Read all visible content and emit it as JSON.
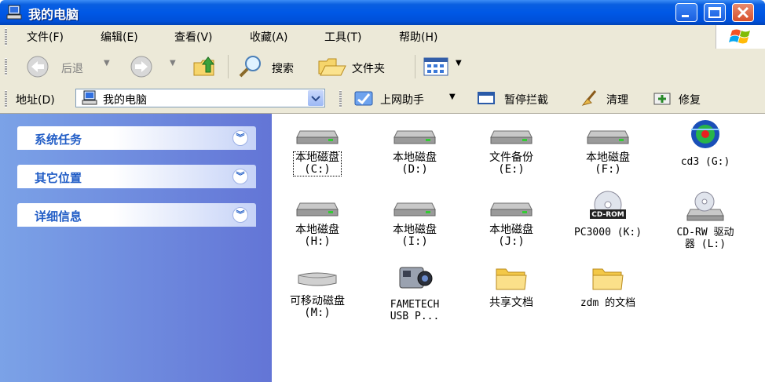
{
  "window": {
    "title": "我的电脑"
  },
  "menu": [
    "文件(F)",
    "编辑(E)",
    "查看(V)",
    "收藏(A)",
    "工具(T)",
    "帮助(H)"
  ],
  "toolbar": {
    "back": "后退",
    "search": "搜索",
    "folders": "文件夹"
  },
  "address": {
    "label": "地址(D)",
    "value": "我的电脑"
  },
  "helper": {
    "assistant": "上网助手",
    "block": "暂停拦截",
    "clean": "清理",
    "repair": "修复"
  },
  "sidebar": [
    "系统任务",
    "其它位置",
    "详细信息"
  ],
  "items": [
    {
      "line1": "本地磁盘",
      "line2": "(C:)",
      "type": "drive"
    },
    {
      "line1": "本地磁盘",
      "line2": "(D:)",
      "type": "drive"
    },
    {
      "line1": "文件备份",
      "line2": "(E:)",
      "type": "drive"
    },
    {
      "line1": "本地磁盘",
      "line2": "(F:)",
      "type": "drive"
    },
    {
      "line1": "cd3 (G:)",
      "line2": "",
      "type": "disc-app"
    },
    {
      "line1": "本地磁盘",
      "line2": "(H:)",
      "type": "drive"
    },
    {
      "line1": "本地磁盘",
      "line2": "(I:)",
      "type": "drive"
    },
    {
      "line1": "本地磁盘",
      "line2": "(J:)",
      "type": "drive"
    },
    {
      "line1": "PC3000 (K:)",
      "line2": "",
      "type": "cdrom"
    },
    {
      "line1": "CD-RW 驱动",
      "line2": "器 (L:)",
      "type": "cdrw"
    },
    {
      "line1": "可移动磁盘",
      "line2": "(M:)",
      "type": "removable"
    },
    {
      "line1": "FAMETECH",
      "line2": "USB P...",
      "type": "camera"
    },
    {
      "line1": "共享文档",
      "line2": "",
      "type": "folder"
    },
    {
      "line1": "zdm 的文档",
      "line2": "",
      "type": "folder"
    }
  ],
  "icons": {
    "cdrom_badge": "CD-ROM"
  }
}
